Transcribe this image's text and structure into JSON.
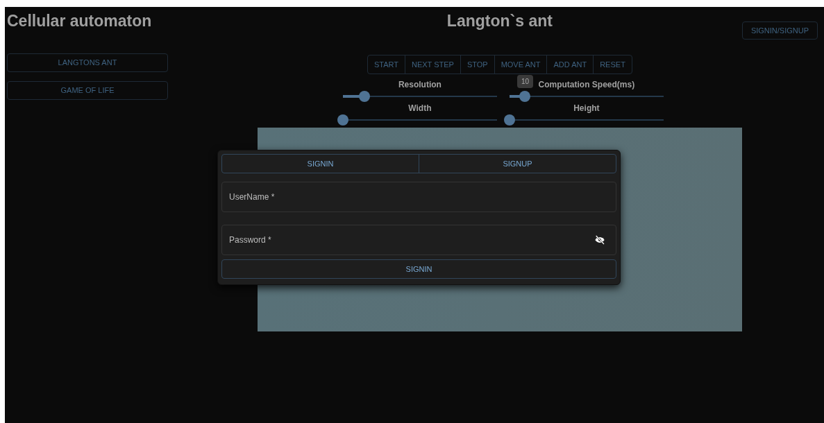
{
  "app_title": "Cellular automaton",
  "sidebar": {
    "items": [
      "LANGTONS ANT",
      "GAME OF LIFE"
    ]
  },
  "page_title": "Langton`s ant",
  "account_button": "SIGNIN/SIGNUP",
  "toolbar": [
    "START",
    "NEXT STEP",
    "STOP",
    "MOVE ANT",
    "ADD ANT",
    "RESET"
  ],
  "sliders": [
    {
      "label": "Resolution",
      "level": 0.14
    },
    {
      "label": "Computation Speed(ms)",
      "level": 0.1,
      "value_label": "10"
    },
    {
      "label": "Width",
      "level": 0
    },
    {
      "label": "Height",
      "level": 0
    }
  ],
  "dialog": {
    "tabs": [
      "SIGNIN",
      "SIGNUP"
    ],
    "fields": [
      {
        "placeholder": "UserName *",
        "kind": "text"
      },
      {
        "placeholder": "Password *",
        "kind": "password"
      }
    ],
    "submit": "SIGNIN"
  }
}
